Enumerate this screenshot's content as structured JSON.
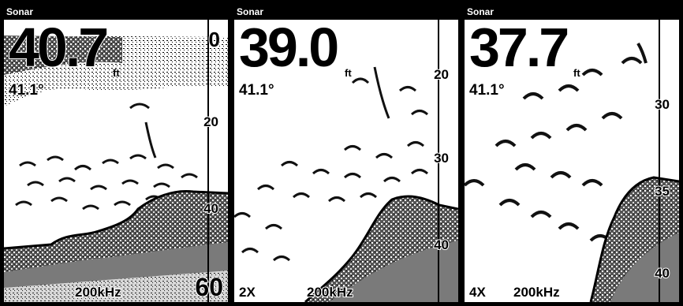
{
  "panels": [
    {
      "title": "Sonar",
      "depth": "40.7",
      "unit": "ft",
      "temp": "41.1°",
      "frequency": "200kHz",
      "zoom": "",
      "scale_top": "0",
      "scale_marks": [
        "20",
        "40"
      ],
      "range_bottom": "60"
    },
    {
      "title": "Sonar",
      "depth": "39.0",
      "unit": "ft",
      "temp": "41.1°",
      "frequency": "200kHz",
      "zoom": "2X",
      "scale_marks": [
        "20",
        "30",
        "40"
      ]
    },
    {
      "title": "Sonar",
      "depth": "37.7",
      "unit": "ft",
      "temp": "41.1°",
      "frequency": "200kHz",
      "zoom": "4X",
      "scale_marks": [
        "30",
        "35",
        "40"
      ]
    }
  ],
  "colors": {
    "frame": "#000000",
    "screen": "#ffffff",
    "echo": "#111111",
    "bottom_fill": "#8a8a8a"
  }
}
